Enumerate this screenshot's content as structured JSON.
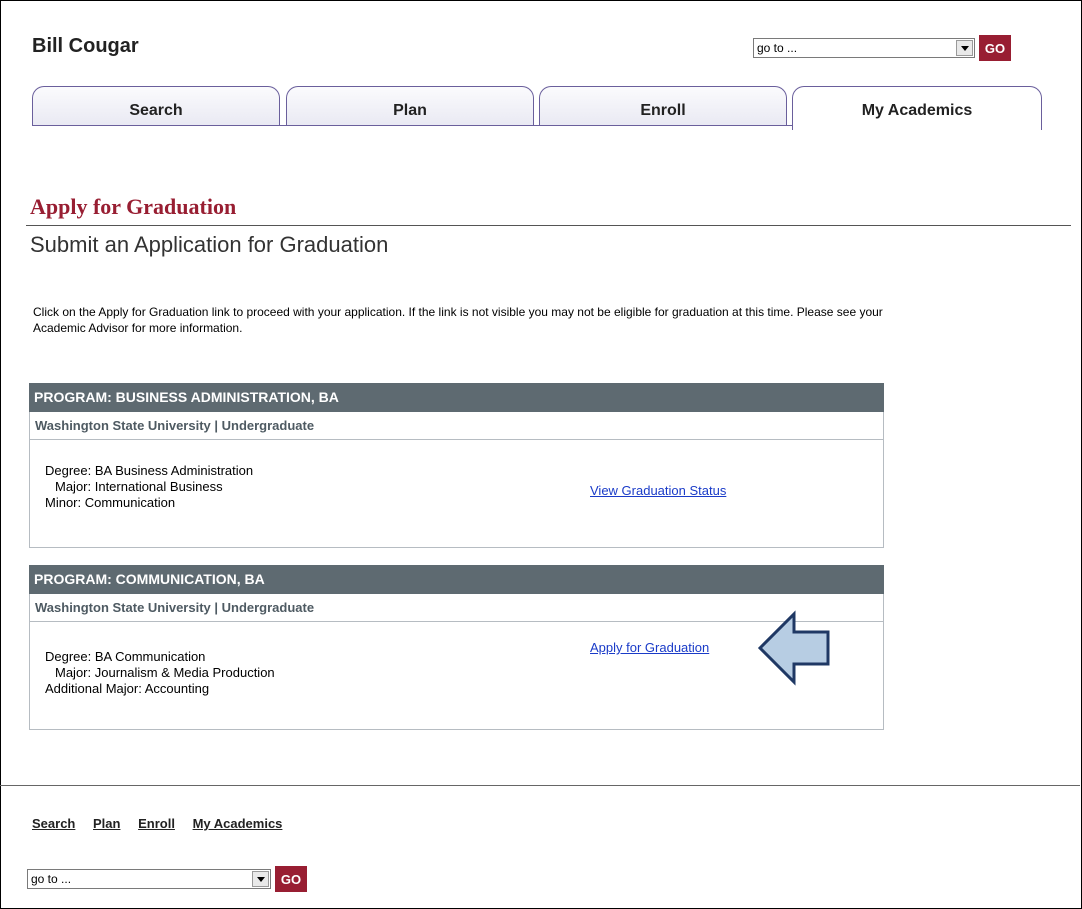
{
  "user": {
    "name": "Bill Cougar"
  },
  "goto": {
    "selected": "go to ...",
    "button": "GO"
  },
  "tabs": [
    {
      "label": "Search",
      "active": false
    },
    {
      "label": "Plan",
      "active": false
    },
    {
      "label": "Enroll",
      "active": false
    },
    {
      "label": "My Academics",
      "active": true
    }
  ],
  "page": {
    "title": "Apply for Graduation",
    "subtitle": "Submit an Application for Graduation",
    "instructions": "Click on the Apply for Graduation link to proceed with your application. If the link is not visible you may not be eligible for graduation at this time. Please see your Academic Advisor for more information."
  },
  "programs": [
    {
      "header": "PROGRAM: BUSINESS ADMINISTRATION, BA",
      "institution": "Washington State University | Undergraduate",
      "degree": "Degree: BA Business Administration",
      "major": "Major: International Business",
      "extra": "Minor: Communication",
      "link": "View Graduation Status"
    },
    {
      "header": "PROGRAM: COMMUNICATION, BA",
      "institution": "Washington State University | Undergraduate",
      "degree": "Degree: BA Communication",
      "major": "Major: Journalism & Media Production",
      "extra": "Additional Major: Accounting",
      "link": "Apply for Graduation"
    }
  ],
  "annotation": {
    "arrow_color": "#b7cde3",
    "arrow_outline": "#1f3864"
  },
  "footer": {
    "links": [
      "Search",
      "Plan",
      "Enroll",
      "My Academics"
    ]
  },
  "colors": {
    "brand": "#981e32",
    "tab_border": "#6a5f9c",
    "program_header": "#5e6a71",
    "link": "#1a3bc8"
  }
}
